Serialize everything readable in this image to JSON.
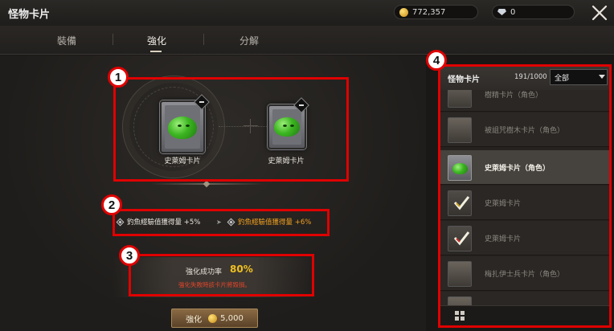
{
  "header": {
    "title": "怪物卡片",
    "gold": "772,357",
    "gems": "0"
  },
  "tabs": [
    {
      "label": "裝備"
    },
    {
      "label": "強化"
    },
    {
      "label": "分解"
    }
  ],
  "enhance": {
    "source_card_label": "史萊姆卡片",
    "target_card_label": "史萊姆卡片",
    "stat_before": "釣魚經驗值獲得量 +5%",
    "stat_after": "釣魚經驗值獲得量 +6%",
    "success_rate_label": "強化成功率",
    "success_rate_value": "80%",
    "fail_warning": "強化失敗時該卡片將毀損。",
    "button_label": "強化",
    "button_cost": "5,000"
  },
  "annotations": [
    "1",
    "2",
    "3",
    "4"
  ],
  "card_list": {
    "title": "怪物卡片",
    "count": "191/1000",
    "filter_value": "全部",
    "items": [
      {
        "label": "樹精卡片（角色）"
      },
      {
        "label": "被詛咒樹木卡片（角色）"
      },
      {
        "label": "史萊姆卡片（角色）"
      },
      {
        "label": "史萊姆卡片"
      },
      {
        "label": "史萊姆卡片"
      },
      {
        "label": "梅扎伊士兵卡片（角色）"
      }
    ]
  },
  "colors": {
    "accent_gold": "#f0c020",
    "warning_red": "#e0452a",
    "annotation_red": "#e00000"
  }
}
